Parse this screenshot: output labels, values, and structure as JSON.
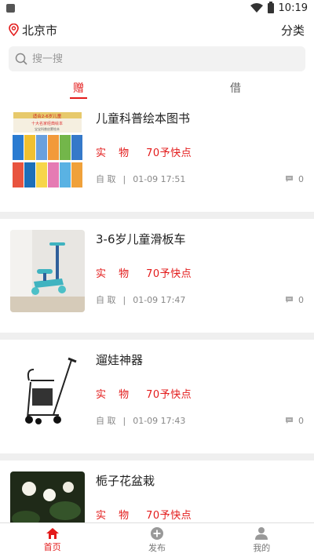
{
  "status_bar": {
    "time": "10:19"
  },
  "header": {
    "city": "北京市",
    "category": "分类"
  },
  "search": {
    "placeholder": "搜一搜"
  },
  "tabs": [
    {
      "label": "赠",
      "active": true
    },
    {
      "label": "借",
      "active": false
    }
  ],
  "items": [
    {
      "title": "儿童科普绘本图书",
      "kind": "实 物",
      "price": "70予快点",
      "pickup": "自 取",
      "time": "01-09 17:51",
      "comments": "0",
      "thumb": "books",
      "banner_top": "适合2-6岁儿童",
      "banner_mid": "十大名家经典绘本",
      "banner_sub": "宝宝科普启蒙绘本"
    },
    {
      "title": "3-6岁儿童滑板车",
      "kind": "实 物",
      "price": "70予快点",
      "pickup": "自 取",
      "time": "01-09 17:47",
      "comments": "0",
      "thumb": "scooter"
    },
    {
      "title": "遛娃神器",
      "kind": "实 物",
      "price": "70予快点",
      "pickup": "自 取",
      "time": "01-09 17:43",
      "comments": "0",
      "thumb": "stroller"
    },
    {
      "title": "栀子花盆栽",
      "kind": "实 物",
      "price": "70予快点",
      "pickup": "自 取",
      "time": "",
      "comments": "",
      "thumb": "flower"
    }
  ],
  "nav": [
    {
      "label": "首页",
      "active": true,
      "icon": "home-icon"
    },
    {
      "label": "发布",
      "active": false,
      "icon": "plus-circle-icon"
    },
    {
      "label": "我的",
      "active": false,
      "icon": "user-icon"
    }
  ],
  "colors": {
    "accent": "#e31b1b",
    "separator": "#efefef"
  }
}
